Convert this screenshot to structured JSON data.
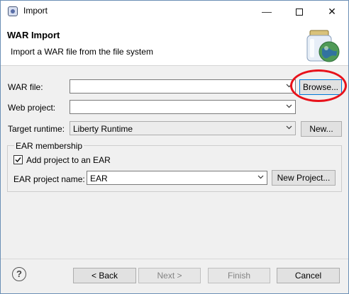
{
  "window": {
    "title": "Import",
    "minimize": "—",
    "close": "✕"
  },
  "header": {
    "title": "WAR Import",
    "description": "Import a WAR file from the file system"
  },
  "form": {
    "war_file": {
      "label": "WAR file:",
      "value": ""
    },
    "browse_label": "Browse...",
    "web_project": {
      "label": "Web project:",
      "value": ""
    },
    "target_runtime": {
      "label": "Target runtime:",
      "value": "Liberty Runtime"
    },
    "new_label": "New..."
  },
  "ear": {
    "legend": "EAR membership",
    "add_to_ear_label": "Add project to an EAR",
    "add_to_ear_checked": true,
    "project_name_label": "EAR project name:",
    "project_name_value": "EAR",
    "new_project_label": "New Project..."
  },
  "footer": {
    "help": "?",
    "back_label": "< Back",
    "next_label": "Next >",
    "finish_label": "Finish",
    "cancel_label": "Cancel"
  },
  "annotation": {
    "color": "#e8121b"
  }
}
